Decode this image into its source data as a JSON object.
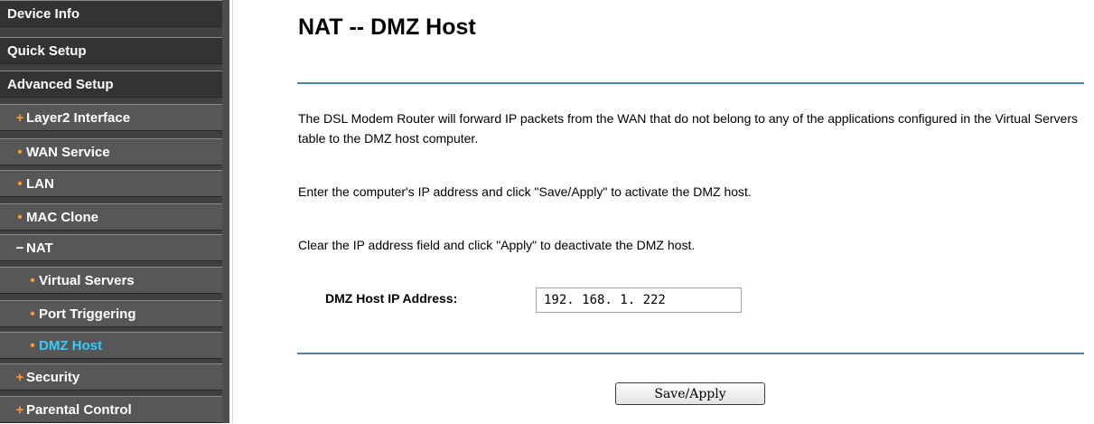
{
  "sidebar": {
    "items": [
      {
        "label": "Device Info",
        "marker": ""
      },
      {
        "label": "Quick Setup",
        "marker": ""
      },
      {
        "label": "Advanced Setup",
        "marker": ""
      },
      {
        "label": "Layer2 Interface",
        "marker": "+"
      },
      {
        "label": "WAN Service",
        "marker": "•"
      },
      {
        "label": "LAN",
        "marker": "•"
      },
      {
        "label": "MAC Clone",
        "marker": "•"
      },
      {
        "label": "NAT",
        "marker": "−"
      },
      {
        "label": "Virtual Servers",
        "marker": "•"
      },
      {
        "label": "Port Triggering",
        "marker": "•"
      },
      {
        "label": "DMZ Host",
        "marker": "•"
      },
      {
        "label": "Security",
        "marker": "+"
      },
      {
        "label": "Parental Control",
        "marker": "+"
      }
    ]
  },
  "page": {
    "title": "NAT -- DMZ Host",
    "description": "The DSL Modem Router will forward IP packets from the WAN that do not belong to any of the applications configured in the Virtual Servers table to the DMZ host computer.",
    "instruction_activate": "Enter the computer's IP address and click \"Save/Apply\" to activate the DMZ host.",
    "instruction_deactivate": "Clear the IP address field and click \"Apply\" to deactivate the DMZ host."
  },
  "form": {
    "dmz_host_ip_label": "DMZ Host IP Address:",
    "dmz_host_ip_value": "192. 168. 1. 222",
    "save_apply_label": "Save/Apply"
  },
  "colors": {
    "sidebar_background": "#404040",
    "active_item": "#33ccff",
    "marker_orange": "#ff9933",
    "divider_blue": "#4a84ab"
  }
}
